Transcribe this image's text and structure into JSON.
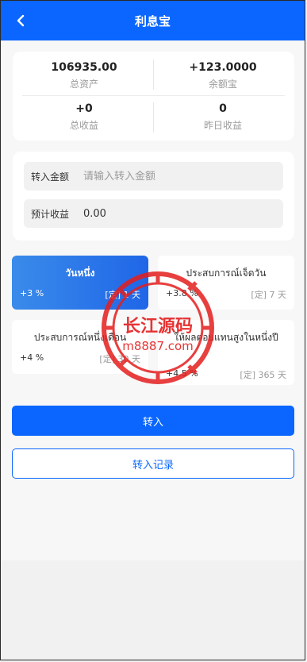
{
  "header": {
    "title": "利息宝"
  },
  "stats": {
    "total_assets": {
      "value": "106935.00",
      "label": "总资产"
    },
    "balance_bao": {
      "value": "+123.0000",
      "label": "余额宝"
    },
    "total_income": {
      "value": "+0",
      "label": "总收益"
    },
    "yesterday_income": {
      "value": "0",
      "label": "昨日收益"
    }
  },
  "form": {
    "transfer_amount": {
      "label": "转入金额",
      "placeholder": "请输入转入金额"
    },
    "expected_income": {
      "label": "预计收益",
      "value": "0.00"
    }
  },
  "plans": [
    {
      "name": "วันหนึ่ง",
      "rate": "+3 %",
      "term": "[定] 1 天",
      "selected": true
    },
    {
      "name": "ประสบการณ์เจ็ดวัน",
      "rate": "+3.8 %",
      "term": "[定] 7 天",
      "selected": false
    },
    {
      "name": "ประสบการณ์หนึ่งเดือน",
      "rate": "+4 %",
      "term": "[定] 30 天",
      "selected": false
    },
    {
      "name": "ให้ผลตอบแทนสูงในหนึ่งปี",
      "rate": "+4.5 %",
      "term": "[定] 365 天",
      "selected": false
    }
  ],
  "buttons": {
    "transfer_in": "转入",
    "transfer_records": "转入记录"
  },
  "watermark": {
    "line1": "长江源码",
    "line2": "m8887.com"
  },
  "colors": {
    "primary": "#0a66ff",
    "watermark_red": "#e41e1e",
    "muted": "#9a9a9a"
  }
}
